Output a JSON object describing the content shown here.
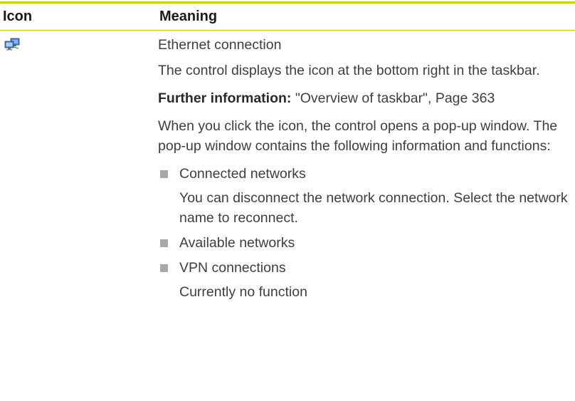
{
  "table": {
    "headers": {
      "icon": "Icon",
      "meaning": "Meaning"
    },
    "row": {
      "icon_name": "network-monitors-icon",
      "title": "Ethernet connection",
      "desc": "The control displays the icon at the bottom right in the taskbar.",
      "further_label": "Further information:",
      "further_ref": " \"Overview of taskbar\", Page 363",
      "popup_desc": "When you click the icon, the control opens a pop-up window. The pop-up window contains the following information and functions:",
      "items": [
        {
          "label": "Connected networks",
          "sub": "You can disconnect the network connection. Select the network name to reconnect."
        },
        {
          "label": "Available networks",
          "sub": ""
        },
        {
          "label": "VPN connections",
          "sub": "Currently no function"
        }
      ]
    }
  },
  "colors": {
    "rule": "#c8d400",
    "bullet": "#a8a8a8",
    "text": "#3e3e3e"
  }
}
